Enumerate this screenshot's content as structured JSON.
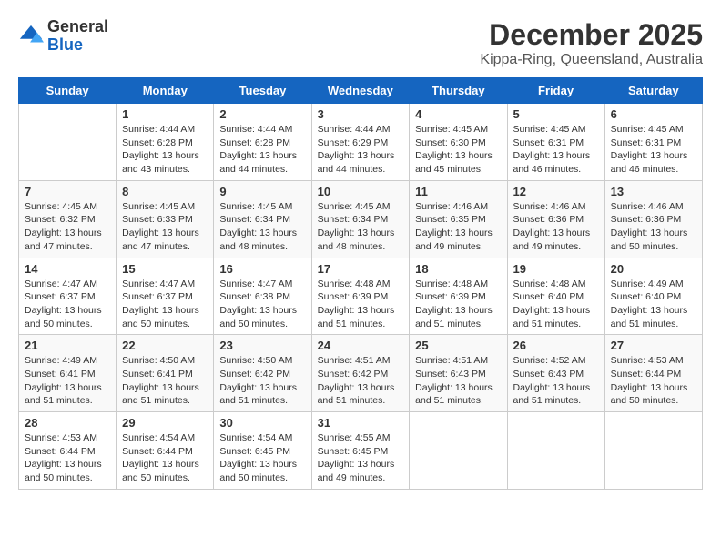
{
  "logo": {
    "general": "General",
    "blue": "Blue"
  },
  "header": {
    "month": "December 2025",
    "location": "Kippa-Ring, Queensland, Australia"
  },
  "weekdays": [
    "Sunday",
    "Monday",
    "Tuesday",
    "Wednesday",
    "Thursday",
    "Friday",
    "Saturday"
  ],
  "weeks": [
    [
      {
        "day": "",
        "sunrise": "",
        "sunset": "",
        "daylight": ""
      },
      {
        "day": "1",
        "sunrise": "Sunrise: 4:44 AM",
        "sunset": "Sunset: 6:28 PM",
        "daylight": "Daylight: 13 hours and 43 minutes."
      },
      {
        "day": "2",
        "sunrise": "Sunrise: 4:44 AM",
        "sunset": "Sunset: 6:28 PM",
        "daylight": "Daylight: 13 hours and 44 minutes."
      },
      {
        "day": "3",
        "sunrise": "Sunrise: 4:44 AM",
        "sunset": "Sunset: 6:29 PM",
        "daylight": "Daylight: 13 hours and 44 minutes."
      },
      {
        "day": "4",
        "sunrise": "Sunrise: 4:45 AM",
        "sunset": "Sunset: 6:30 PM",
        "daylight": "Daylight: 13 hours and 45 minutes."
      },
      {
        "day": "5",
        "sunrise": "Sunrise: 4:45 AM",
        "sunset": "Sunset: 6:31 PM",
        "daylight": "Daylight: 13 hours and 46 minutes."
      },
      {
        "day": "6",
        "sunrise": "Sunrise: 4:45 AM",
        "sunset": "Sunset: 6:31 PM",
        "daylight": "Daylight: 13 hours and 46 minutes."
      }
    ],
    [
      {
        "day": "7",
        "sunrise": "Sunrise: 4:45 AM",
        "sunset": "Sunset: 6:32 PM",
        "daylight": "Daylight: 13 hours and 47 minutes."
      },
      {
        "day": "8",
        "sunrise": "Sunrise: 4:45 AM",
        "sunset": "Sunset: 6:33 PM",
        "daylight": "Daylight: 13 hours and 47 minutes."
      },
      {
        "day": "9",
        "sunrise": "Sunrise: 4:45 AM",
        "sunset": "Sunset: 6:34 PM",
        "daylight": "Daylight: 13 hours and 48 minutes."
      },
      {
        "day": "10",
        "sunrise": "Sunrise: 4:45 AM",
        "sunset": "Sunset: 6:34 PM",
        "daylight": "Daylight: 13 hours and 48 minutes."
      },
      {
        "day": "11",
        "sunrise": "Sunrise: 4:46 AM",
        "sunset": "Sunset: 6:35 PM",
        "daylight": "Daylight: 13 hours and 49 minutes."
      },
      {
        "day": "12",
        "sunrise": "Sunrise: 4:46 AM",
        "sunset": "Sunset: 6:36 PM",
        "daylight": "Daylight: 13 hours and 49 minutes."
      },
      {
        "day": "13",
        "sunrise": "Sunrise: 4:46 AM",
        "sunset": "Sunset: 6:36 PM",
        "daylight": "Daylight: 13 hours and 50 minutes."
      }
    ],
    [
      {
        "day": "14",
        "sunrise": "Sunrise: 4:47 AM",
        "sunset": "Sunset: 6:37 PM",
        "daylight": "Daylight: 13 hours and 50 minutes."
      },
      {
        "day": "15",
        "sunrise": "Sunrise: 4:47 AM",
        "sunset": "Sunset: 6:37 PM",
        "daylight": "Daylight: 13 hours and 50 minutes."
      },
      {
        "day": "16",
        "sunrise": "Sunrise: 4:47 AM",
        "sunset": "Sunset: 6:38 PM",
        "daylight": "Daylight: 13 hours and 50 minutes."
      },
      {
        "day": "17",
        "sunrise": "Sunrise: 4:48 AM",
        "sunset": "Sunset: 6:39 PM",
        "daylight": "Daylight: 13 hours and 51 minutes."
      },
      {
        "day": "18",
        "sunrise": "Sunrise: 4:48 AM",
        "sunset": "Sunset: 6:39 PM",
        "daylight": "Daylight: 13 hours and 51 minutes."
      },
      {
        "day": "19",
        "sunrise": "Sunrise: 4:48 AM",
        "sunset": "Sunset: 6:40 PM",
        "daylight": "Daylight: 13 hours and 51 minutes."
      },
      {
        "day": "20",
        "sunrise": "Sunrise: 4:49 AM",
        "sunset": "Sunset: 6:40 PM",
        "daylight": "Daylight: 13 hours and 51 minutes."
      }
    ],
    [
      {
        "day": "21",
        "sunrise": "Sunrise: 4:49 AM",
        "sunset": "Sunset: 6:41 PM",
        "daylight": "Daylight: 13 hours and 51 minutes."
      },
      {
        "day": "22",
        "sunrise": "Sunrise: 4:50 AM",
        "sunset": "Sunset: 6:41 PM",
        "daylight": "Daylight: 13 hours and 51 minutes."
      },
      {
        "day": "23",
        "sunrise": "Sunrise: 4:50 AM",
        "sunset": "Sunset: 6:42 PM",
        "daylight": "Daylight: 13 hours and 51 minutes."
      },
      {
        "day": "24",
        "sunrise": "Sunrise: 4:51 AM",
        "sunset": "Sunset: 6:42 PM",
        "daylight": "Daylight: 13 hours and 51 minutes."
      },
      {
        "day": "25",
        "sunrise": "Sunrise: 4:51 AM",
        "sunset": "Sunset: 6:43 PM",
        "daylight": "Daylight: 13 hours and 51 minutes."
      },
      {
        "day": "26",
        "sunrise": "Sunrise: 4:52 AM",
        "sunset": "Sunset: 6:43 PM",
        "daylight": "Daylight: 13 hours and 51 minutes."
      },
      {
        "day": "27",
        "sunrise": "Sunrise: 4:53 AM",
        "sunset": "Sunset: 6:44 PM",
        "daylight": "Daylight: 13 hours and 50 minutes."
      }
    ],
    [
      {
        "day": "28",
        "sunrise": "Sunrise: 4:53 AM",
        "sunset": "Sunset: 6:44 PM",
        "daylight": "Daylight: 13 hours and 50 minutes."
      },
      {
        "day": "29",
        "sunrise": "Sunrise: 4:54 AM",
        "sunset": "Sunset: 6:44 PM",
        "daylight": "Daylight: 13 hours and 50 minutes."
      },
      {
        "day": "30",
        "sunrise": "Sunrise: 4:54 AM",
        "sunset": "Sunset: 6:45 PM",
        "daylight": "Daylight: 13 hours and 50 minutes."
      },
      {
        "day": "31",
        "sunrise": "Sunrise: 4:55 AM",
        "sunset": "Sunset: 6:45 PM",
        "daylight": "Daylight: 13 hours and 49 minutes."
      },
      {
        "day": "",
        "sunrise": "",
        "sunset": "",
        "daylight": ""
      },
      {
        "day": "",
        "sunrise": "",
        "sunset": "",
        "daylight": ""
      },
      {
        "day": "",
        "sunrise": "",
        "sunset": "",
        "daylight": ""
      }
    ]
  ]
}
